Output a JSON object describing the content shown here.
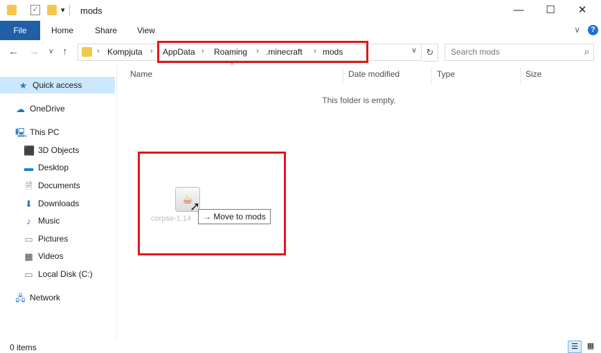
{
  "window": {
    "title": "mods",
    "minimize_glyph": "—",
    "maximize_glyph": "☐",
    "close_glyph": "✕",
    "qa_dropdown_glyph": "▾"
  },
  "ribbon": {
    "tabs": [
      "File",
      "Home",
      "Share",
      "View"
    ],
    "expand_glyph": "∨",
    "help_glyph": "?"
  },
  "nav": {
    "back_glyph": "←",
    "forward_glyph": "→",
    "recent_glyph": "∨",
    "up_glyph": "↑",
    "breadcrumb": [
      "Kompjuta",
      "AppData",
      "Roaming",
      ".minecraft",
      "mods"
    ],
    "crumb_separator": "›",
    "dropdown_glyph": "∨",
    "refresh_glyph": "↻",
    "search_placeholder": "Search mods",
    "search_glyph": "⌕"
  },
  "sidebar": {
    "items": [
      {
        "label": "Quick access",
        "icon": "star-icon",
        "glyph": "★",
        "color": "#2b78c5"
      },
      {
        "label": "OneDrive",
        "icon": "cloud-icon",
        "glyph": "☁",
        "color": "#1a73d6"
      },
      {
        "label": "This PC",
        "icon": "computer-icon",
        "glyph": "🖳",
        "color": "#2b78c5"
      },
      {
        "label": "3D Objects",
        "icon": "cube-icon",
        "glyph": "⬛",
        "color": "#3aa0e0"
      },
      {
        "label": "Desktop",
        "icon": "desktop-icon",
        "glyph": "▬",
        "color": "#1f7fd3"
      },
      {
        "label": "Documents",
        "icon": "document-icon",
        "glyph": "🗎",
        "color": "#7a8797"
      },
      {
        "label": "Downloads",
        "icon": "download-icon",
        "glyph": "⬇",
        "color": "#2b78c5"
      },
      {
        "label": "Music",
        "icon": "music-icon",
        "glyph": "♪",
        "color": "#2b78c5"
      },
      {
        "label": "Pictures",
        "icon": "pictures-icon",
        "glyph": "▭",
        "color": "#7a8797"
      },
      {
        "label": "Videos",
        "icon": "video-icon",
        "glyph": "▦",
        "color": "#444444"
      },
      {
        "label": "Local Disk (C:)",
        "icon": "drive-icon",
        "glyph": "▭",
        "color": "#6f7a85"
      },
      {
        "label": "Network",
        "icon": "network-icon",
        "glyph": "🖧",
        "color": "#2b78c5"
      }
    ]
  },
  "content": {
    "columns": [
      "Name",
      "Date modified",
      "Type",
      "Size"
    ],
    "sort_glyph": "^",
    "empty_message": "This folder is empty.",
    "drag_item_label": "corpse-1.14",
    "drag_item_glyph": "☕",
    "cursor_glyph": "➚",
    "tooltip_arrow": "→",
    "tooltip_text": "Move to mods"
  },
  "status": {
    "item_count": "0 items",
    "details_view_glyph": "☰",
    "large_icons_glyph": "▦"
  },
  "colors": {
    "accent": "#1f5fa6",
    "selection": "#cce8ff",
    "highlight_box": "#e0161b",
    "folder": "#f3c74e"
  }
}
